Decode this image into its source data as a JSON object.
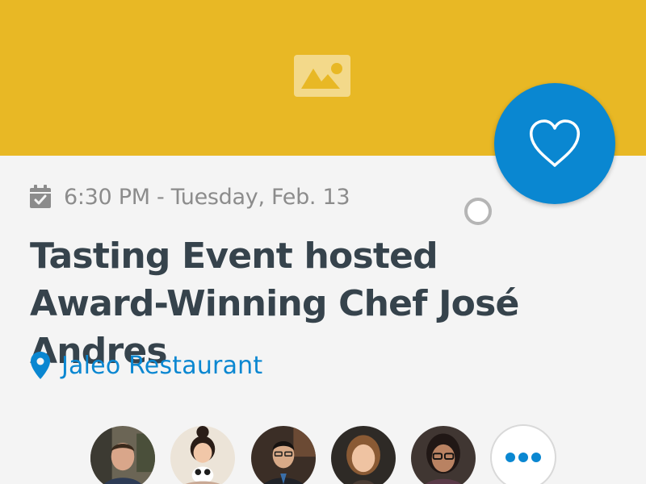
{
  "event": {
    "date_time": "6:30 PM - Tuesday, Feb. 13",
    "title": "Tasting Event hosted Award-Winning Chef José Andres",
    "location": "Jaleo Restaurant"
  },
  "icons": {
    "hero": "image-placeholder-icon",
    "favorite": "heart-icon",
    "date": "calendar-check-icon",
    "location": "map-pin-icon",
    "more": "more-dots-icon"
  },
  "attendees": {
    "count_visible": 5
  },
  "colors": {
    "hero_background": "#e8b825",
    "accent_blue": "#0a87d1",
    "title_text": "#36434c",
    "muted_text": "#8c8c8c",
    "page_background": "#f4f4f4"
  }
}
